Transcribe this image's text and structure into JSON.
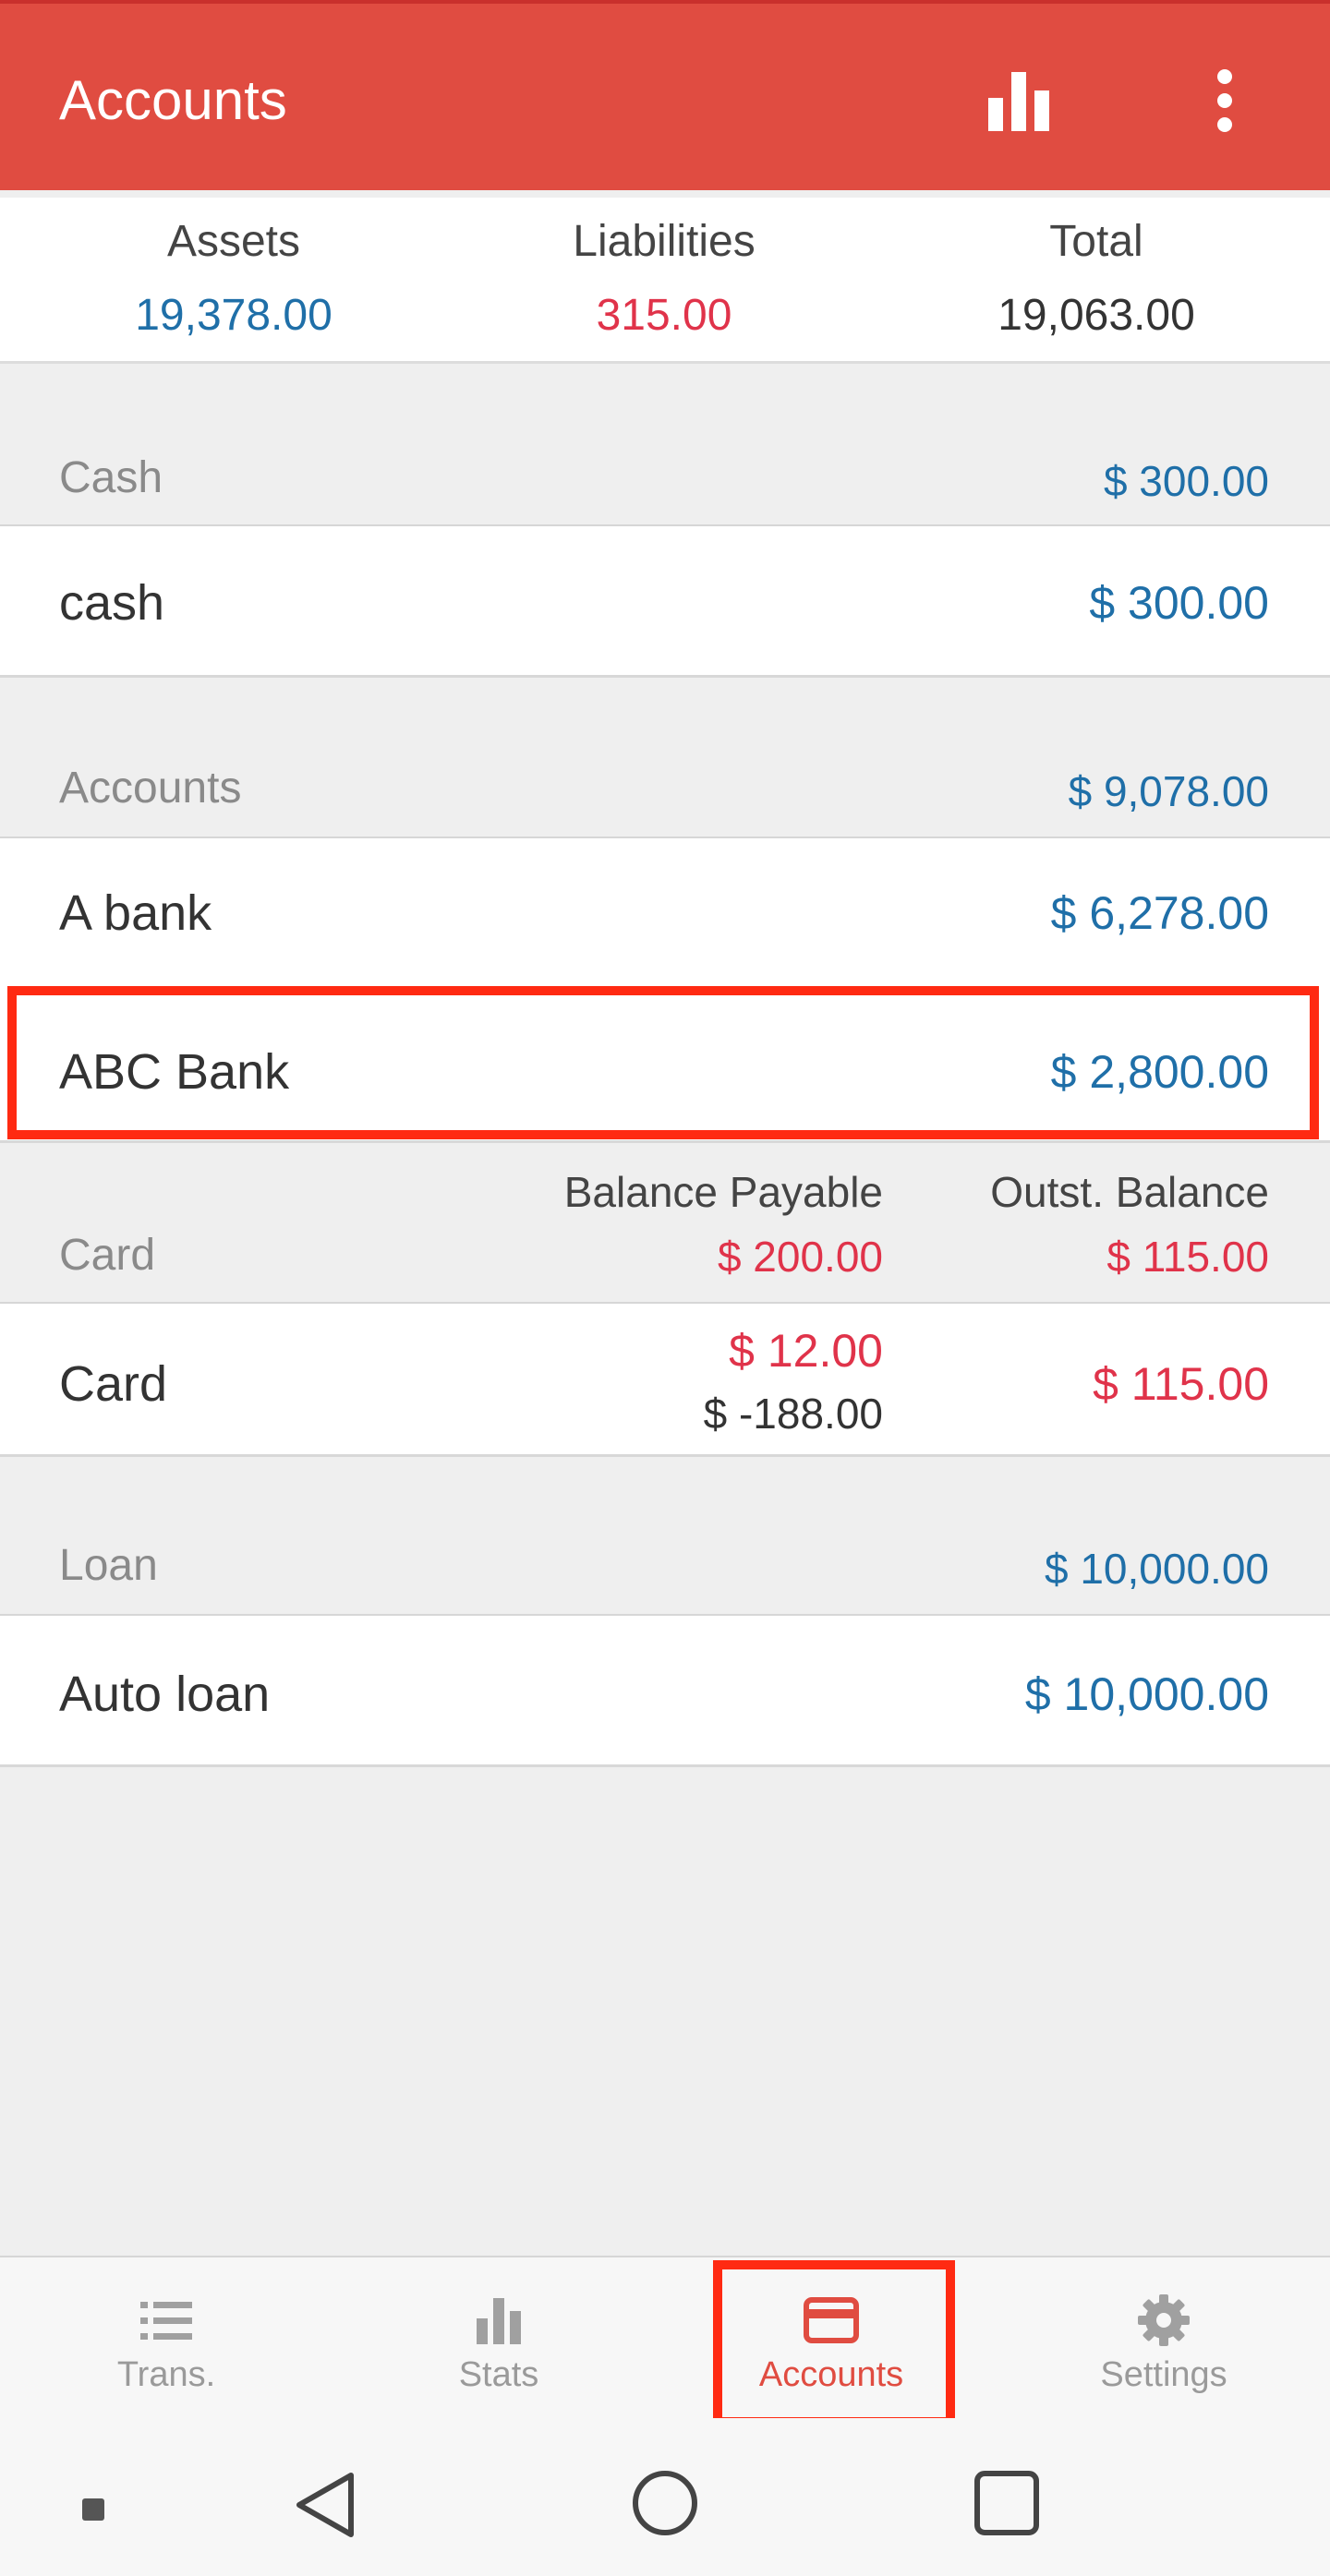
{
  "appbar": {
    "title": "Accounts",
    "icons": [
      "bar-chart-icon",
      "more-vert-icon"
    ]
  },
  "summary": {
    "assets_label": "Assets",
    "assets_value": "19,378.00",
    "liabilities_label": "Liabilities",
    "liabilities_value": "315.00",
    "total_label": "Total",
    "total_value": "19,063.00"
  },
  "groups": {
    "cash": {
      "name": "Cash",
      "amount": "$ 300.00",
      "items": [
        {
          "name": "cash",
          "amount": "$ 300.00"
        }
      ]
    },
    "accounts": {
      "name": "Accounts",
      "amount": "$ 9,078.00",
      "items": [
        {
          "name": "A bank",
          "amount": "$ 6,278.00"
        },
        {
          "name": "ABC Bank",
          "amount": "$ 2,800.00"
        }
      ]
    },
    "card": {
      "name": "Card",
      "balance_payable_label": "Balance Payable",
      "balance_payable_value": "$ 200.00",
      "outst_balance_label": "Outst. Balance",
      "outst_balance_value": "$ 115.00",
      "items": [
        {
          "name": "Card",
          "payable": "$ 12.00",
          "payable_sub": "$ -188.00",
          "amount": "$ 115.00"
        }
      ]
    },
    "loan": {
      "name": "Loan",
      "amount": "$ 10,000.00",
      "items": [
        {
          "name": "Auto loan",
          "amount": "$ 10,000.00"
        }
      ]
    }
  },
  "bottom_nav": [
    {
      "label": "Trans.",
      "icon": "list-icon"
    },
    {
      "label": "Stats",
      "icon": "bar-chart-icon"
    },
    {
      "label": "Accounts",
      "icon": "card-icon",
      "active": true
    },
    {
      "label": "Settings",
      "icon": "gear-icon"
    }
  ],
  "colors": {
    "primary": "#e04c41",
    "positive": "#1f6fa8",
    "negative": "#e0334a",
    "highlight": "#ff2a12"
  }
}
